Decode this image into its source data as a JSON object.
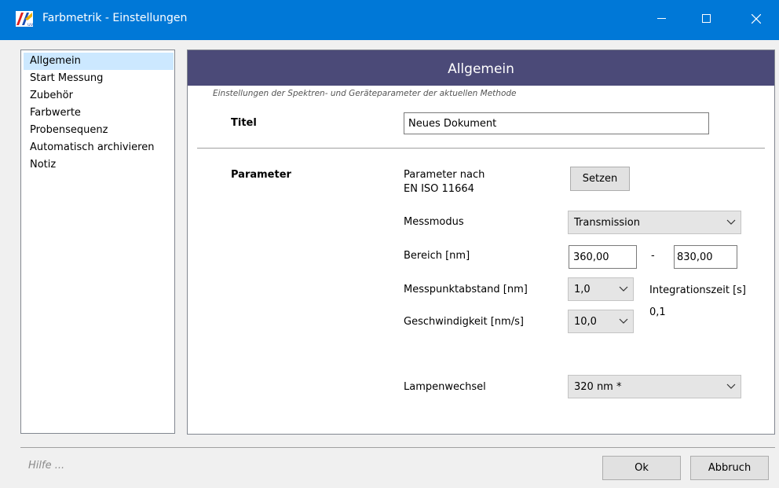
{
  "window": {
    "title": "Farbmetrik - Einstellungen",
    "accent_color": "#0078d7",
    "icons": {
      "app": "farbmetrik-app-icon",
      "minimize": "minimize-icon",
      "maximize": "maximize-icon",
      "close": "close-icon"
    }
  },
  "sidebar": {
    "items": [
      {
        "label": "Allgemein",
        "selected": true
      },
      {
        "label": "Start Messung"
      },
      {
        "label": "Zubehör"
      },
      {
        "label": "Farbwerte"
      },
      {
        "label": "Probensequenz"
      },
      {
        "label": "Automatisch archivieren"
      },
      {
        "label": "Notiz"
      }
    ]
  },
  "panel": {
    "header": "Allgemein",
    "header_color": "#4b4a78",
    "subtitle": "Einstellungen der Spektren- und Geräteparameter der aktuellen Methode",
    "title_label": "Titel",
    "title_value": "Neues Dokument",
    "parameter_label": "Parameter",
    "parameter_norm_line1": "Parameter nach",
    "parameter_norm_line2": "EN ISO 11664",
    "set_button": "Setzen",
    "messmodus_label": "Messmodus",
    "messmodus_value": "Transmission",
    "bereich_label": "Bereich [nm]",
    "bereich_from": "360,00",
    "bereich_separator": "-",
    "bereich_to": "830,00",
    "messpunkt_label": "Messpunktabstand [nm]",
    "messpunkt_value": "1,0",
    "integration_label": "Integrationszeit [s]",
    "integration_value": "0,1",
    "geschwindigkeit_label": "Geschwindigkeit [nm/s]",
    "geschwindigkeit_value": "10,0",
    "lampenwechsel_label": "Lampenwechsel",
    "lampenwechsel_value": "320 nm *"
  },
  "footer": {
    "help": "Hilfe ...",
    "ok": "Ok",
    "cancel": "Abbruch"
  }
}
